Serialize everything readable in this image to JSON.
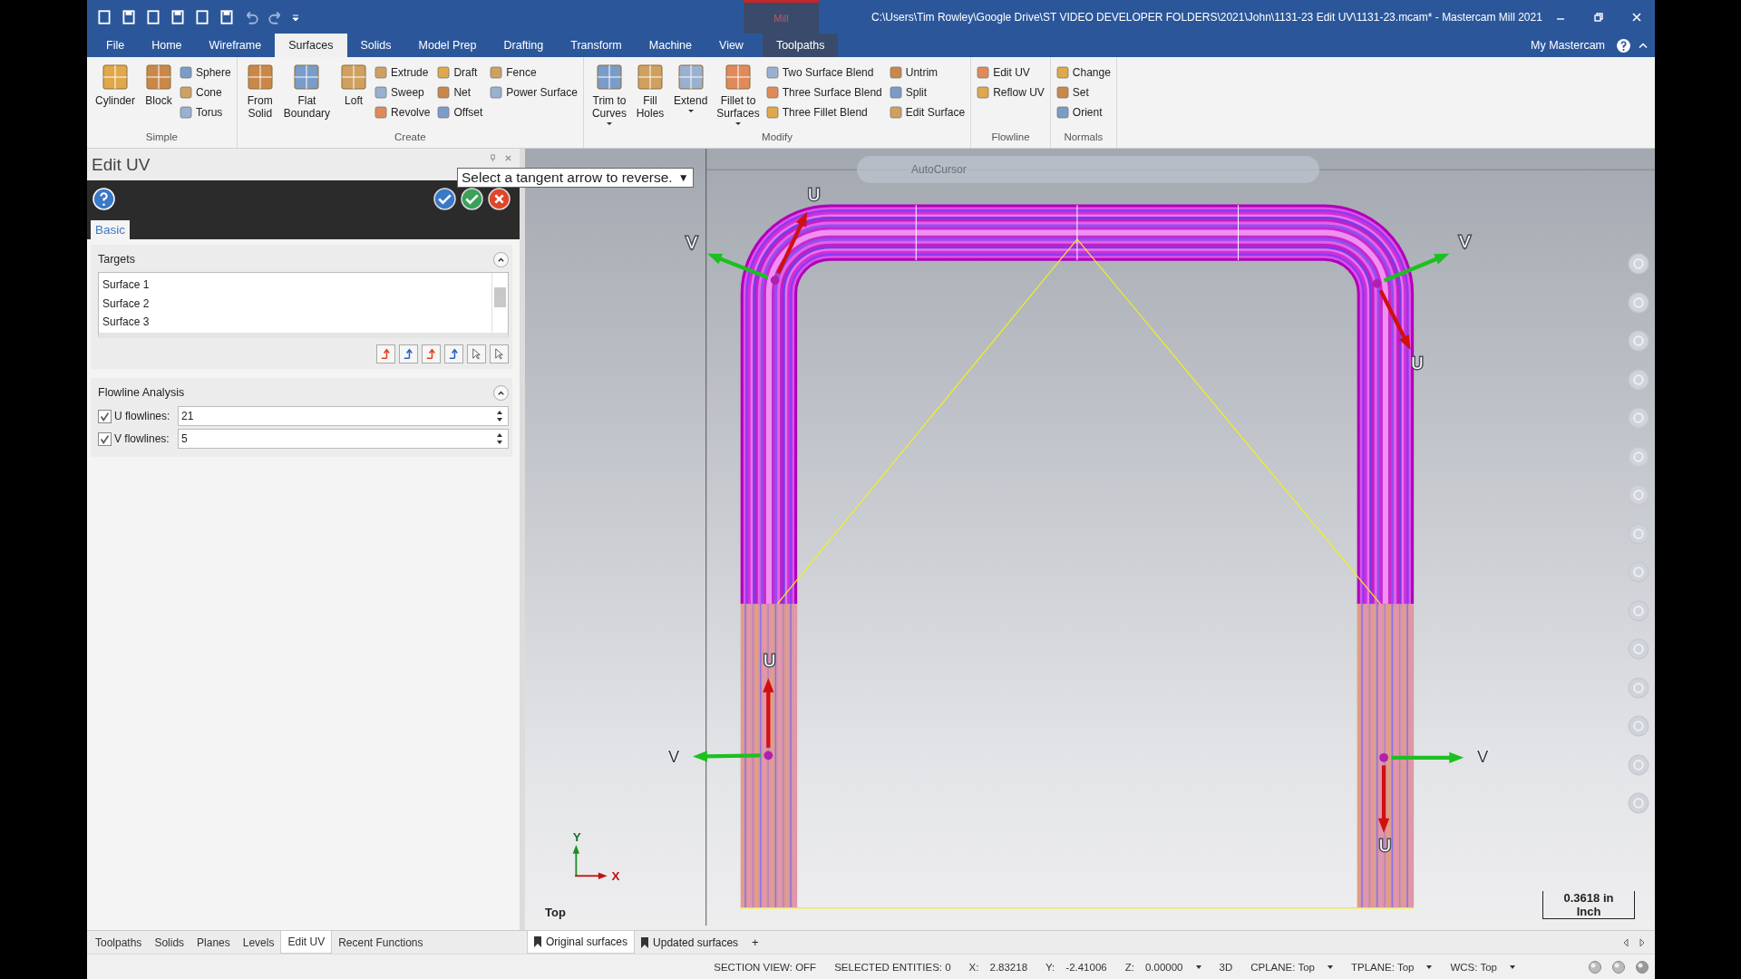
{
  "window": {
    "title": "C:\\Users\\Tim Rowley\\Google Drive\\ST VIDEO DEVELOPER FOLDERS\\2021\\John\\1131-23 Edit UV\\1131-23.mcam* - Mastercam Mill 2021",
    "context_label": "Mill"
  },
  "tabs": [
    {
      "label": "File",
      "selected": false
    },
    {
      "label": "Home",
      "selected": false
    },
    {
      "label": "Wireframe",
      "selected": false
    },
    {
      "label": "Surfaces",
      "selected": true
    },
    {
      "label": "Solids",
      "selected": false
    },
    {
      "label": "Model Prep",
      "selected": false
    },
    {
      "label": "Drafting",
      "selected": false
    },
    {
      "label": "Transform",
      "selected": false
    },
    {
      "label": "Machine",
      "selected": false
    },
    {
      "label": "View",
      "selected": false
    },
    {
      "label": "Toolpaths",
      "selected": false,
      "kind": "contextual"
    }
  ],
  "account": {
    "label": "My Mastercam"
  },
  "ribbon": {
    "groups": [
      {
        "label": "Simple",
        "large": [
          {
            "label": "Cylinder",
            "dropdown": false
          },
          {
            "label": "Block",
            "dropdown": false
          }
        ],
        "small": [
          "Sphere",
          "Cone",
          "Torus"
        ]
      },
      {
        "label": "Create",
        "large": [
          {
            "label": "From\nSolid",
            "dropdown": false
          },
          {
            "label": "Flat\nBoundary",
            "dropdown": false
          },
          {
            "label": "Loft",
            "dropdown": false
          }
        ],
        "small": [
          "Extrude",
          "Sweep",
          "Revolve",
          "Draft",
          "Net",
          "Offset",
          "Fence",
          "Power Surface"
        ]
      },
      {
        "label": "Modify",
        "large": [
          {
            "label": "Trim to\nCurves",
            "dropdown": true
          },
          {
            "label": "Fill\nHoles",
            "dropdown": false
          },
          {
            "label": "Extend",
            "dropdown": true
          },
          {
            "label": "Fillet to\nSurfaces",
            "dropdown": true
          }
        ],
        "small": [
          "Two Surface Blend",
          "Three Surface Blend",
          "Three Fillet Blend",
          "Untrim",
          "Split",
          "Edit Surface"
        ]
      },
      {
        "label": "Flowline",
        "small": [
          "Edit UV",
          "Reflow UV"
        ]
      },
      {
        "label": "Normals",
        "small": [
          "Change",
          "Set",
          "Orient"
        ]
      }
    ]
  },
  "panel": {
    "title": "Edit UV",
    "tabs": [
      {
        "label": "Basic",
        "selected": true
      }
    ],
    "sections": [
      {
        "title": "Targets",
        "expanded": true,
        "kind": "list",
        "items": [
          "Surface 1",
          "Surface 2",
          "Surface 3"
        ]
      },
      {
        "title": "Flowline Analysis",
        "expanded": true,
        "kind": "fields",
        "fields": [
          {
            "label": "U flowlines:",
            "checked": true,
            "value": "21"
          },
          {
            "label": "V flowlines:",
            "checked": true,
            "value": "5"
          }
        ]
      }
    ]
  },
  "bottom_tabs": [
    {
      "label": "Toolpaths",
      "selected": false
    },
    {
      "label": "Solids",
      "selected": false
    },
    {
      "label": "Planes",
      "selected": false
    },
    {
      "label": "Levels",
      "selected": false
    },
    {
      "label": "Edit UV",
      "selected": true
    },
    {
      "label": "Recent Functions",
      "selected": false
    }
  ],
  "viewport": {
    "tooltip": {
      "text": "Select a tangent arrow to reverse.",
      "arrow": "▼"
    },
    "autocursor": "AutoCursor",
    "view_label": "Top",
    "axis": {
      "y": "Y",
      "x": "X"
    },
    "scale": {
      "value": "0.3618 in",
      "unit": "Inch"
    },
    "uv_markers": [
      {
        "u": "U",
        "v": "V"
      },
      {
        "u": "U",
        "v": "V"
      },
      {
        "u": "U",
        "v": "V"
      },
      {
        "u": "U",
        "v": "V"
      }
    ]
  },
  "viewport_tabs": [
    {
      "label": "Original surfaces",
      "selected": true
    },
    {
      "label": "Updated surfaces",
      "selected": false
    }
  ],
  "viewport_tab_add": "+",
  "status_bar": [
    {
      "label": "SECTION VIEW: OFF",
      "dropdown": false
    },
    {
      "label": "SELECTED ENTITIES: 0",
      "dropdown": false
    },
    {
      "label": "X:",
      "value": "2.83218",
      "dropdown": false
    },
    {
      "label": "Y:",
      "value": "-2.41006",
      "dropdown": false
    },
    {
      "label": "Z:",
      "value": "0.00000",
      "dropdown": true
    },
    {
      "label": "3D",
      "dropdown": false
    },
    {
      "label": "CPLANE: Top",
      "dropdown": true
    },
    {
      "label": "TPLANE: Top",
      "dropdown": true
    },
    {
      "label": "WCS: Top",
      "dropdown": true
    }
  ]
}
